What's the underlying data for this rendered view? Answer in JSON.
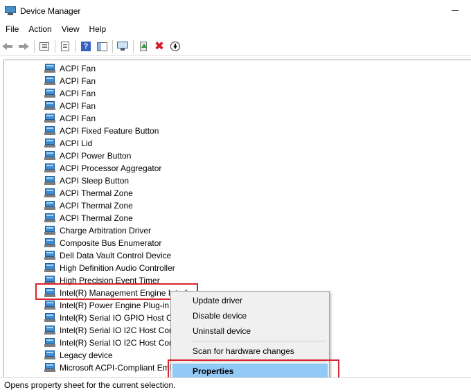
{
  "window": {
    "title": "Device Manager"
  },
  "menu": [
    "File",
    "Action",
    "View",
    "Help"
  ],
  "toolbar": {
    "icons": [
      "back-arrow-icon",
      "forward-arrow-icon",
      "show-hide-console-tree-icon",
      "properties-icon",
      "help-icon",
      "action-pane-icon",
      "scan-hardware-icon",
      "update-driver-icon",
      "uninstall-device-icon",
      "enable-device-icon"
    ]
  },
  "devices": [
    "ACPI Fan",
    "ACPI Fan",
    "ACPI Fan",
    "ACPI Fan",
    "ACPI Fan",
    "ACPI Fixed Feature Button",
    "ACPI Lid",
    "ACPI Power Button",
    "ACPI Processor Aggregator",
    "ACPI Sleep Button",
    "ACPI Thermal Zone",
    "ACPI Thermal Zone",
    "ACPI Thermal Zone",
    "Charge Arbitration Driver",
    "Composite Bus Enumerator",
    "Dell Data Vault Control Device",
    "High Definition Audio Controller",
    "High Precision Event Timer",
    "Intel(R) Management Engine Interface",
    "Intel(R) Power Engine Plug-in",
    "Intel(R) Serial IO GPIO Host Controller",
    "Intel(R) Serial IO I2C Host Controller",
    "Intel(R) Serial IO I2C Host Controller",
    "Legacy device",
    "Microsoft ACPI-Compliant Embedded Controller"
  ],
  "context_menu": {
    "items": [
      "Update driver",
      "Disable device",
      "Uninstall device",
      "Scan for hardware changes",
      "Properties"
    ],
    "active": "Properties"
  },
  "status": {
    "text": "Opens property sheet for the current selection."
  },
  "colors": {
    "highlight": "#d9232d",
    "menu_active": "#91c9f7",
    "device_icon": "#3c8fd6"
  }
}
